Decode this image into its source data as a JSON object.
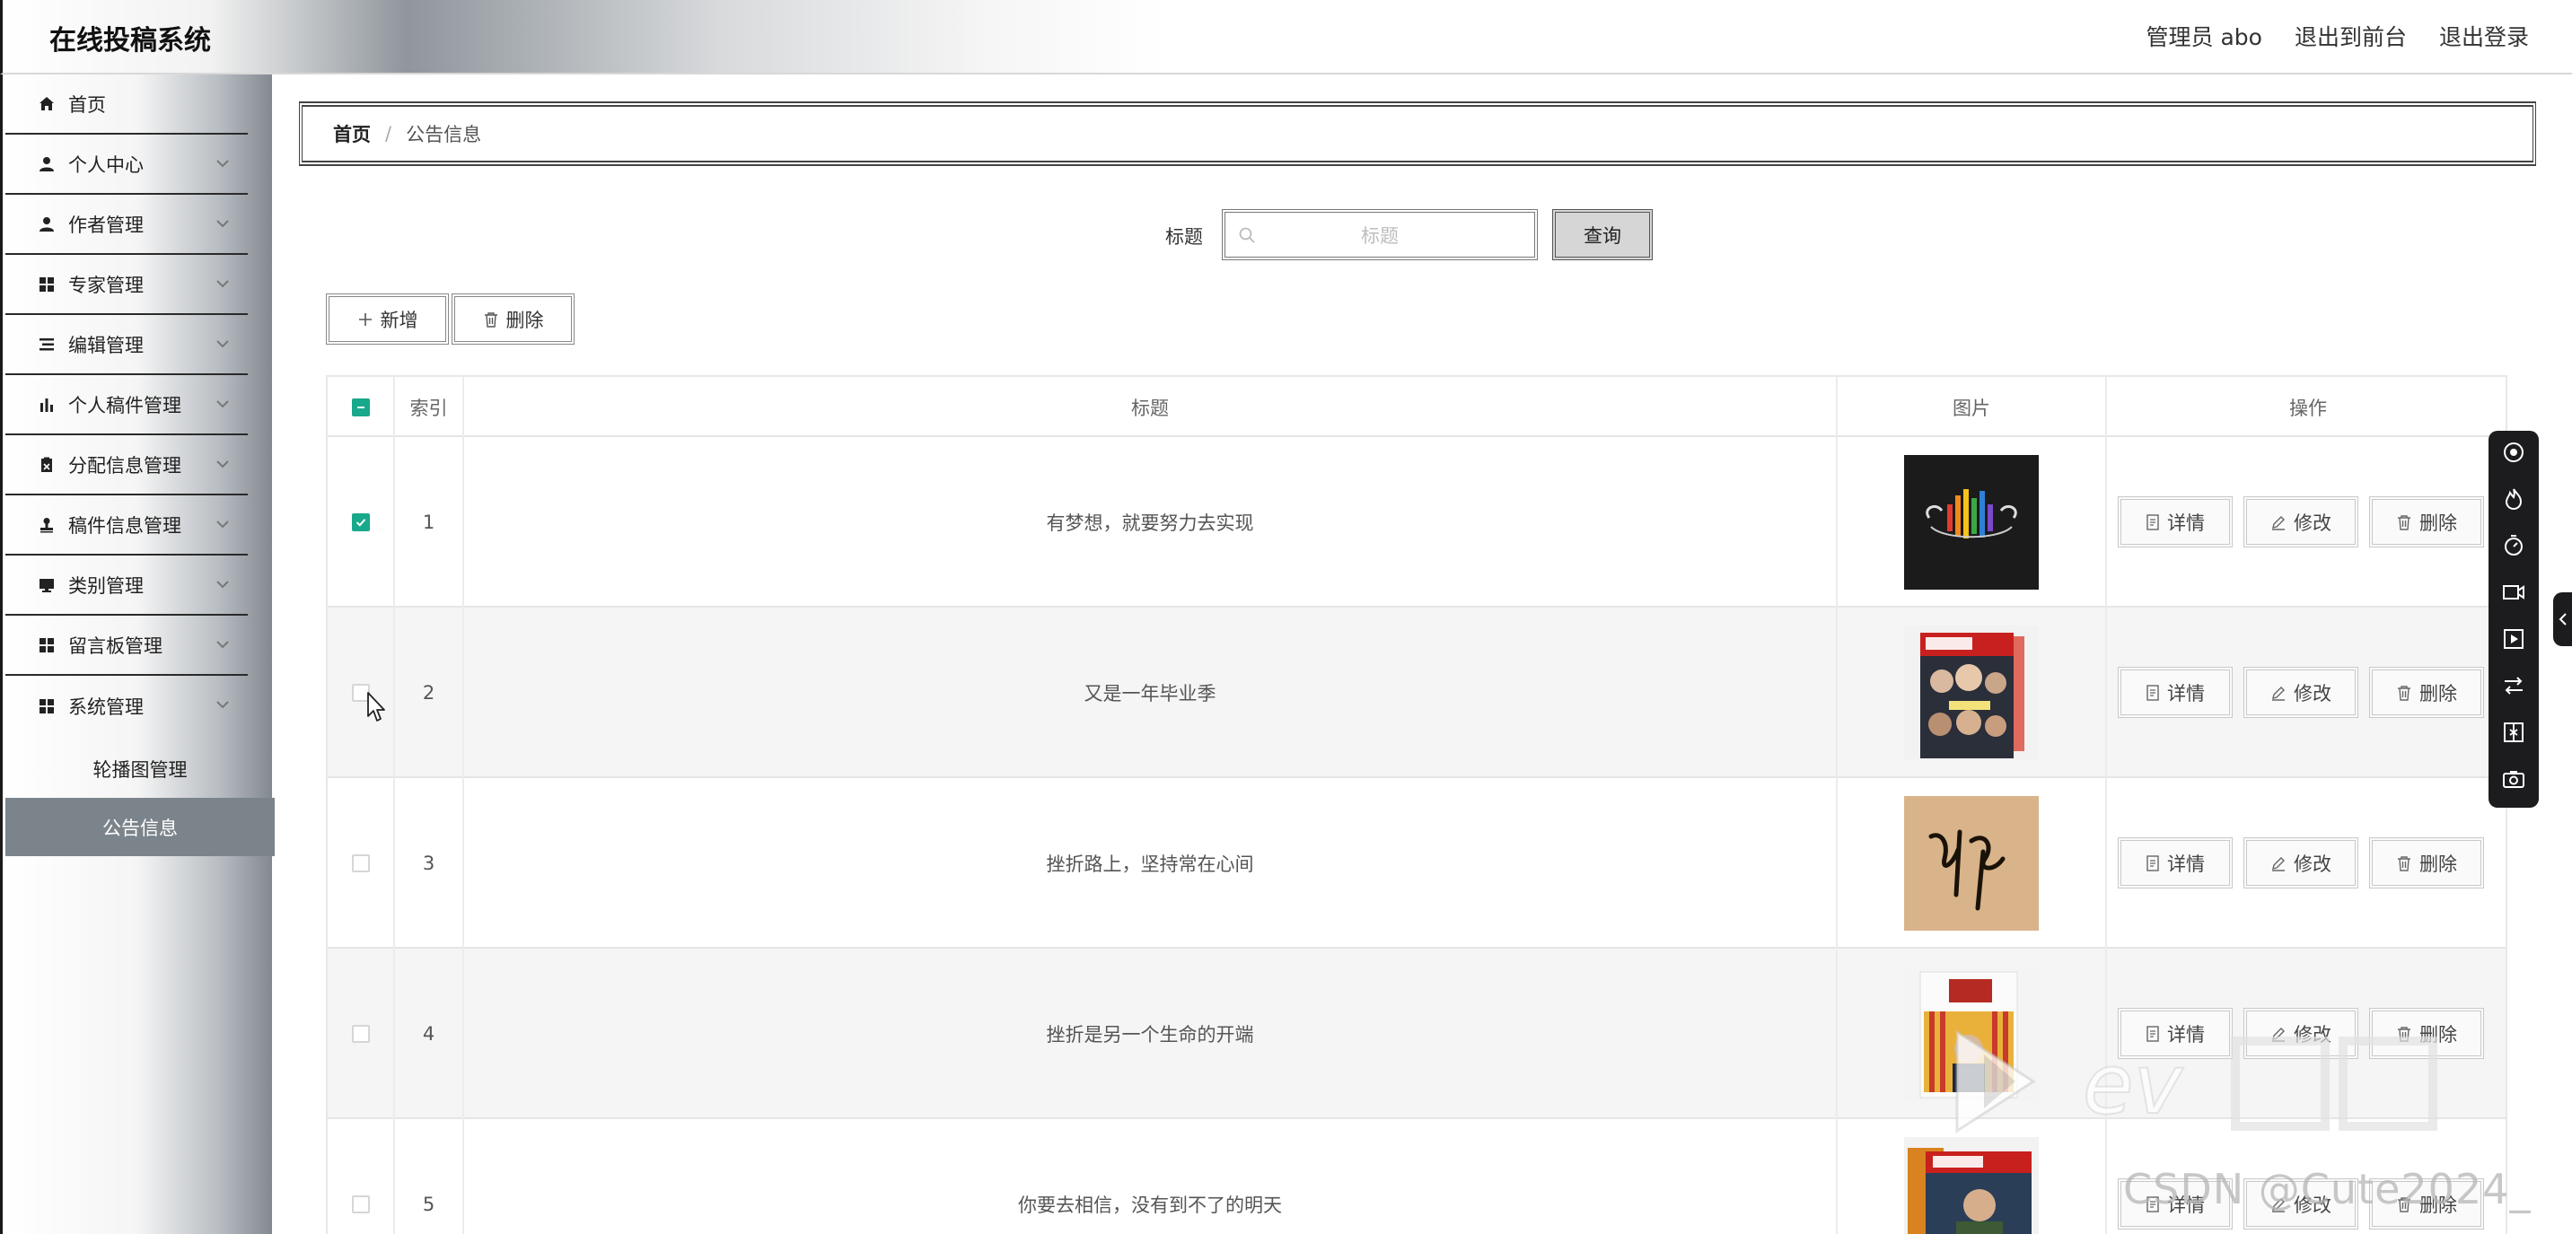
{
  "header": {
    "app_title": "在线投稿系统",
    "admin_label": "管理员 abo",
    "to_frontend": "退出到前台",
    "logout": "退出登录"
  },
  "sidebar": {
    "items": [
      {
        "label": "首页",
        "icon": "home-icon"
      },
      {
        "label": "个人中心",
        "icon": "user-icon"
      },
      {
        "label": "作者管理",
        "icon": "user-icon"
      },
      {
        "label": "专家管理",
        "icon": "grid-icon"
      },
      {
        "label": "编辑管理",
        "icon": "list-icon"
      },
      {
        "label": "个人稿件管理",
        "icon": "bar-chart-icon"
      },
      {
        "label": "分配信息管理",
        "icon": "clipboard-icon"
      },
      {
        "label": "稿件信息管理",
        "icon": "stamp-icon"
      },
      {
        "label": "类别管理",
        "icon": "monitor-icon"
      },
      {
        "label": "留言板管理",
        "icon": "grid-icon"
      },
      {
        "label": "系统管理",
        "icon": "grid-icon"
      }
    ],
    "sub_items": [
      {
        "label": "轮播图管理",
        "active": false
      },
      {
        "label": "公告信息",
        "active": true
      }
    ]
  },
  "breadcrumb": {
    "home": "首页",
    "separator": "/",
    "current": "公告信息"
  },
  "search": {
    "label": "标题",
    "placeholder": "标题",
    "button": "查询"
  },
  "toolbar": {
    "add": "新增",
    "delete": "删除"
  },
  "table": {
    "columns": [
      "索引",
      "标题",
      "图片",
      "操作"
    ],
    "rows": [
      {
        "index": "1",
        "title": "有梦想，就要努力去实现",
        "checked": true
      },
      {
        "index": "2",
        "title": "又是一年毕业季",
        "checked": false
      },
      {
        "index": "3",
        "title": "挫折路上，坚持常在心间",
        "checked": false
      },
      {
        "index": "4",
        "title": "挫折是另一个生命的开端",
        "checked": false
      },
      {
        "index": "5",
        "title": "你要去相信，没有到不了的明天",
        "checked": false
      }
    ],
    "actions": {
      "detail": "详情",
      "edit": "修改",
      "delete": "删除"
    }
  },
  "watermark": {
    "csdn": "CSDN @Cute2024_"
  },
  "colors": {
    "accent_green": "#18a88b",
    "sidebar_active": "#7c848b",
    "float_bar": "#1c1c1e"
  }
}
